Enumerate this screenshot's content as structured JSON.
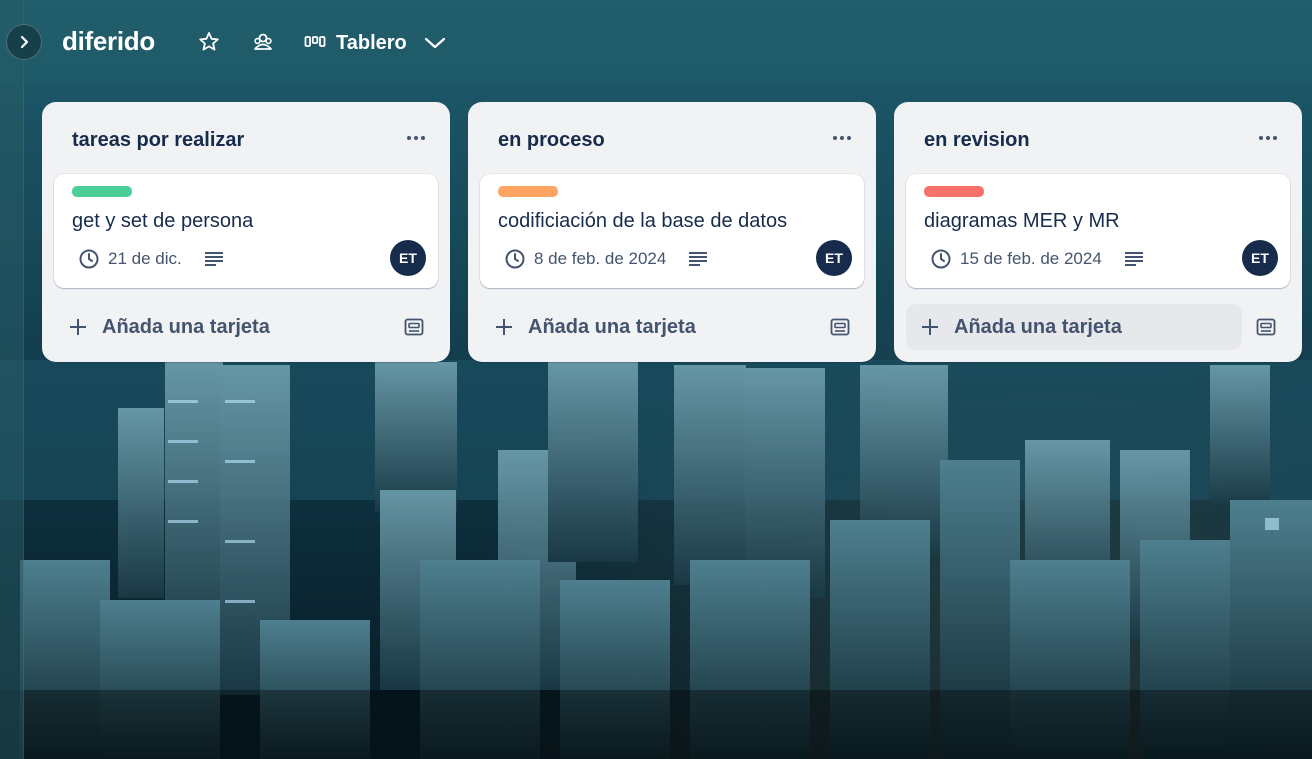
{
  "board": {
    "title": "diferido",
    "view_label": "Tablero"
  },
  "icons": {
    "sidebar_toggle": "chevron-right-icon",
    "star": "star-icon",
    "visibility": "team-visibility-icon",
    "view": "board-view-icon",
    "view_dropdown": "chevron-down-icon",
    "list_menu": "more-horizontal-icon",
    "date": "clock-icon",
    "description": "description-icon",
    "add": "plus-icon",
    "template": "card-template-icon"
  },
  "colors": {
    "label_green": "#4bce97",
    "label_orange": "#fea362",
    "label_red": "#f87168",
    "avatar_bg": "#172b4d"
  },
  "lists": [
    {
      "title": "tareas por realizar",
      "cards": [
        {
          "title": "get y set de persona",
          "label_color": "#4bce97",
          "due": "21 de dic.",
          "member": "ET"
        }
      ],
      "add_label": "Añada una tarjeta"
    },
    {
      "title": "en proceso",
      "cards": [
        {
          "title": "codificiación de la base de datos",
          "label_color": "#fea362",
          "due": "8 de feb. de 2024",
          "member": "ET"
        }
      ],
      "add_label": "Añada una tarjeta"
    },
    {
      "title": "en revision",
      "cards": [
        {
          "title": "diagramas MER y MR",
          "label_color": "#f87168",
          "due": "15 de feb. de 2024",
          "member": "ET"
        }
      ],
      "add_label": "Añada una tarjeta"
    }
  ]
}
